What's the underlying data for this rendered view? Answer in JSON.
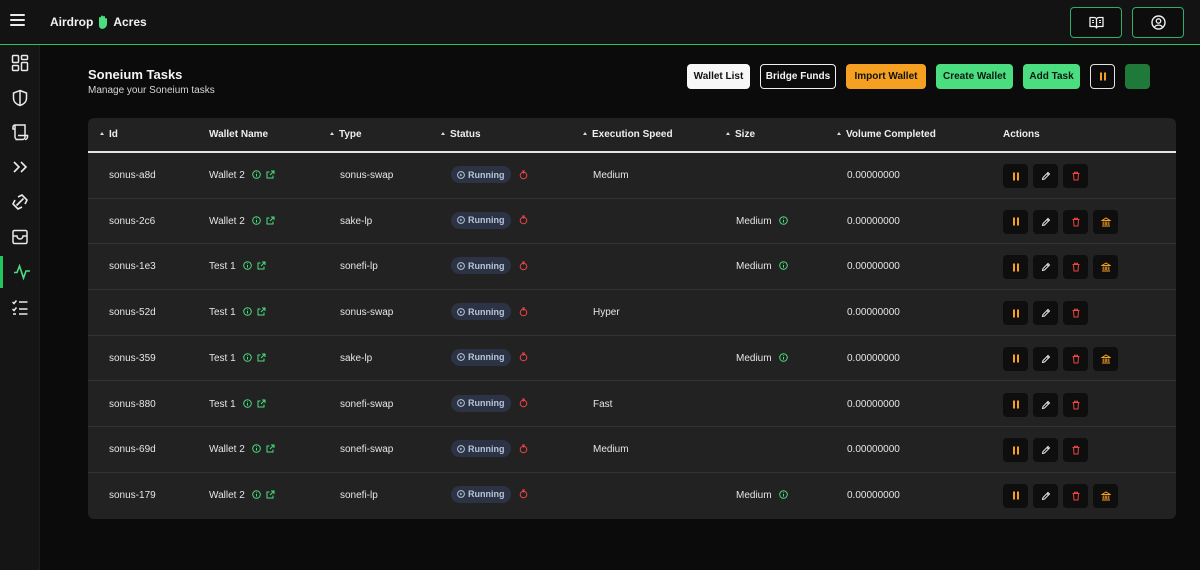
{
  "app": {
    "brand_left": "Airdrop",
    "brand_right": "Acres"
  },
  "colors": {
    "accent": "#22c55e",
    "orange": "#f5a020",
    "danger": "#ef4444",
    "card": "#222222",
    "background": "#0b0b0b"
  },
  "topbar": {
    "menu_icon": "hamburger-icon",
    "right_buttons": [
      "book-open-icon",
      "user-circle-icon"
    ]
  },
  "sidebar": {
    "items": [
      {
        "icon": "dashboard-icon"
      },
      {
        "icon": "shield-icon"
      },
      {
        "icon": "scroll-icon"
      },
      {
        "icon": "chevrons-right-icon"
      },
      {
        "icon": "bridge-icon"
      },
      {
        "icon": "inbox-icon"
      },
      {
        "icon": "activity-icon",
        "active": true
      },
      {
        "icon": "list-check-icon"
      }
    ]
  },
  "header": {
    "title": "Soneium Tasks",
    "subtitle": "Manage your Soneium tasks"
  },
  "toolbar": {
    "wallet_list": "Wallet List",
    "bridge_funds": "Bridge Funds",
    "import_wallet": "Import Wallet",
    "create_wallet": "Create Wallet",
    "add_task": "Add Task",
    "pause_icon": "pause-icon"
  },
  "table": {
    "columns": {
      "id": "Id",
      "wallet_name": "Wallet Name",
      "type": "Type",
      "status": "Status",
      "execution_speed": "Execution Speed",
      "size": "Size",
      "volume_completed": "Volume Completed",
      "actions": "Actions"
    },
    "rows": [
      {
        "id": "sonus-a8d",
        "wallet": "Wallet 2",
        "type": "sonus-swap",
        "status": "Running",
        "speed": "Medium",
        "size": "",
        "volume": "0.00000000",
        "withdraw": false
      },
      {
        "id": "sonus-2c6",
        "wallet": "Wallet 2",
        "type": "sake-lp",
        "status": "Running",
        "speed": "",
        "size": "Medium",
        "volume": "0.00000000",
        "withdraw": true
      },
      {
        "id": "sonus-1e3",
        "wallet": "Test 1",
        "type": "sonefi-lp",
        "status": "Running",
        "speed": "",
        "size": "Medium",
        "volume": "0.00000000",
        "withdraw": true
      },
      {
        "id": "sonus-52d",
        "wallet": "Test 1",
        "type": "sonus-swap",
        "status": "Running",
        "speed": "Hyper",
        "size": "",
        "volume": "0.00000000",
        "withdraw": false
      },
      {
        "id": "sonus-359",
        "wallet": "Test 1",
        "type": "sake-lp",
        "status": "Running",
        "speed": "",
        "size": "Medium",
        "volume": "0.00000000",
        "withdraw": true
      },
      {
        "id": "sonus-880",
        "wallet": "Test 1",
        "type": "sonefi-swap",
        "status": "Running",
        "speed": "Fast",
        "size": "",
        "volume": "0.00000000",
        "withdraw": false
      },
      {
        "id": "sonus-69d",
        "wallet": "Wallet 2",
        "type": "sonefi-swap",
        "status": "Running",
        "speed": "Medium",
        "size": "",
        "volume": "0.00000000",
        "withdraw": false
      },
      {
        "id": "sonus-179",
        "wallet": "Wallet 2",
        "type": "sonefi-lp",
        "status": "Running",
        "speed": "",
        "size": "Medium",
        "volume": "0.00000000",
        "withdraw": true
      }
    ]
  }
}
